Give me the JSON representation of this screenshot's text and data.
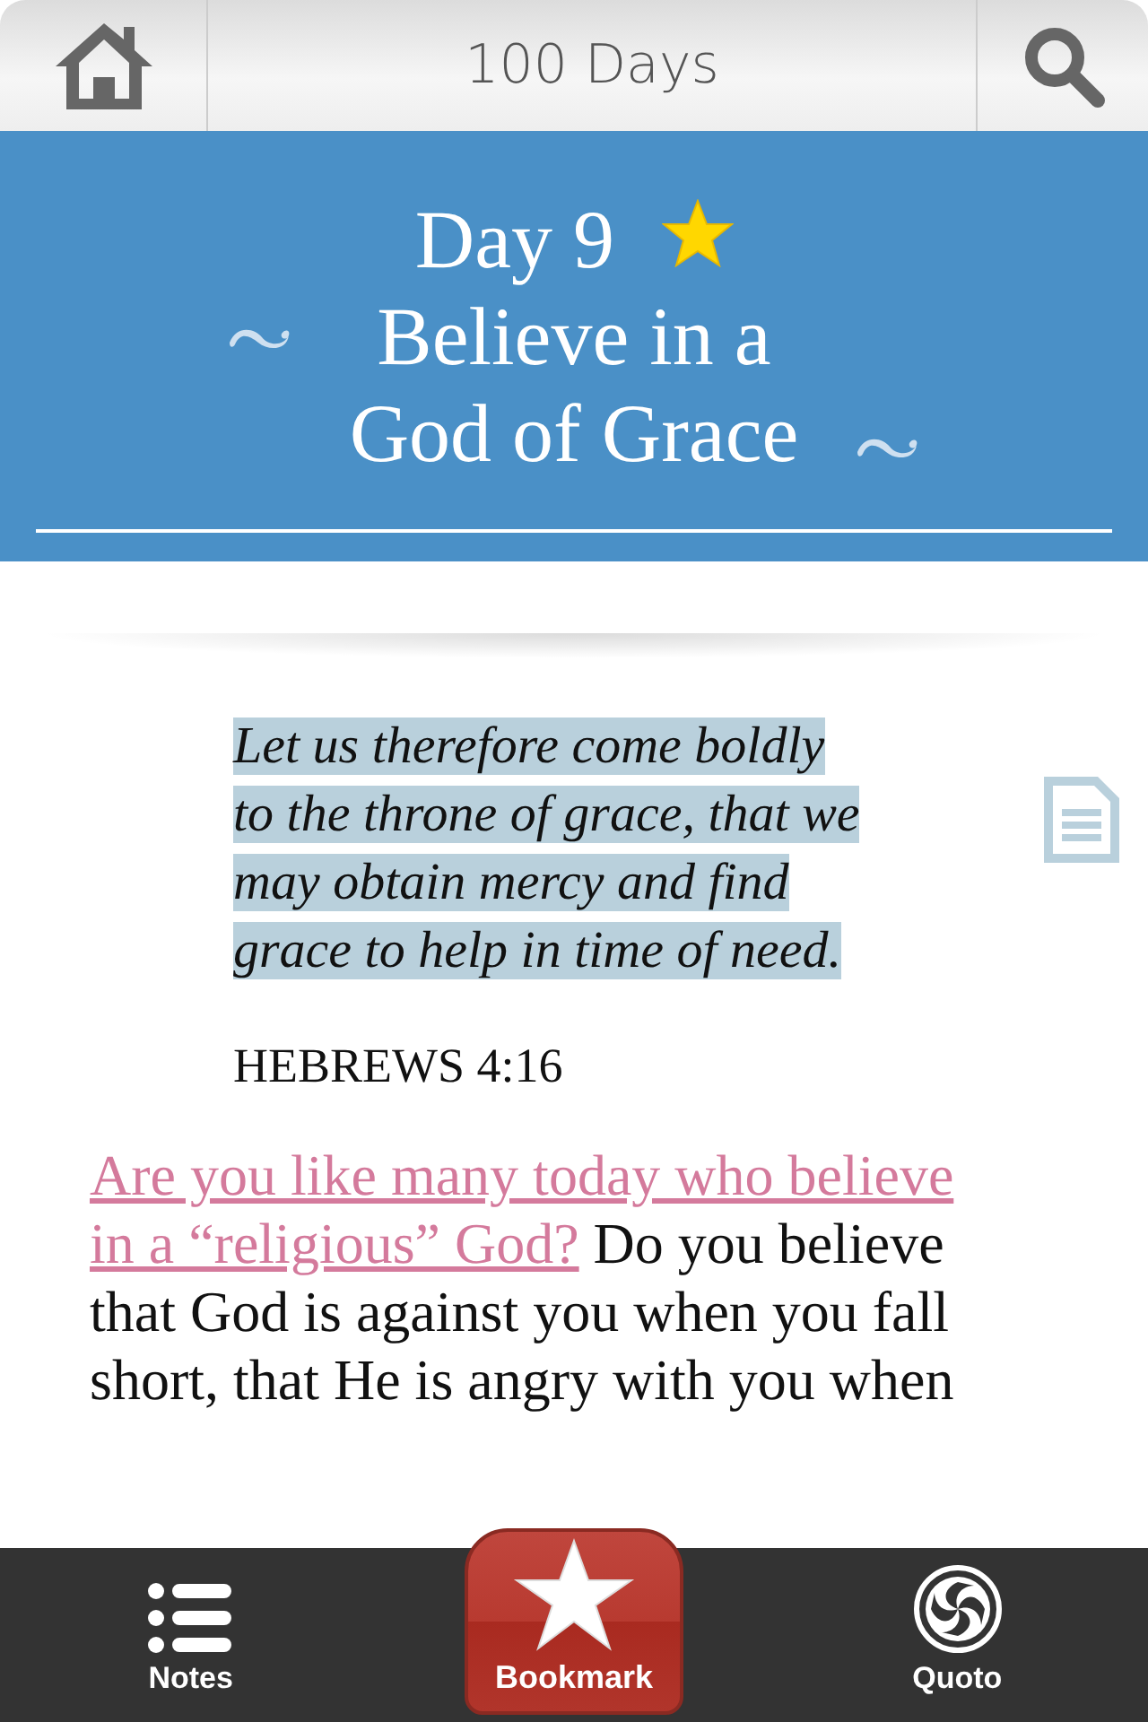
{
  "top_bar": {
    "title": "100 Days"
  },
  "header": {
    "day": "Day 9",
    "starred": true,
    "title": "Believe in a God of Grace"
  },
  "verse": {
    "text": "Let us therefore come boldly to the throne of grace, that we may obtain mercy and find grace to help in time of need.",
    "highlighted": true,
    "reference": "HEBREWS 4:16"
  },
  "body": {
    "link_lines": [
      "Are you like many today who believe",
      "in a “religious” God?"
    ],
    "text": "Do you believe that God is against you when you fall short, that He is angry with you when"
  },
  "bottom_bar": [
    {
      "kind": "notes",
      "label": "Notes"
    },
    {
      "kind": "bookmark",
      "label": "Bookmark"
    },
    {
      "kind": "quoto",
      "label": "Quoto"
    }
  ]
}
